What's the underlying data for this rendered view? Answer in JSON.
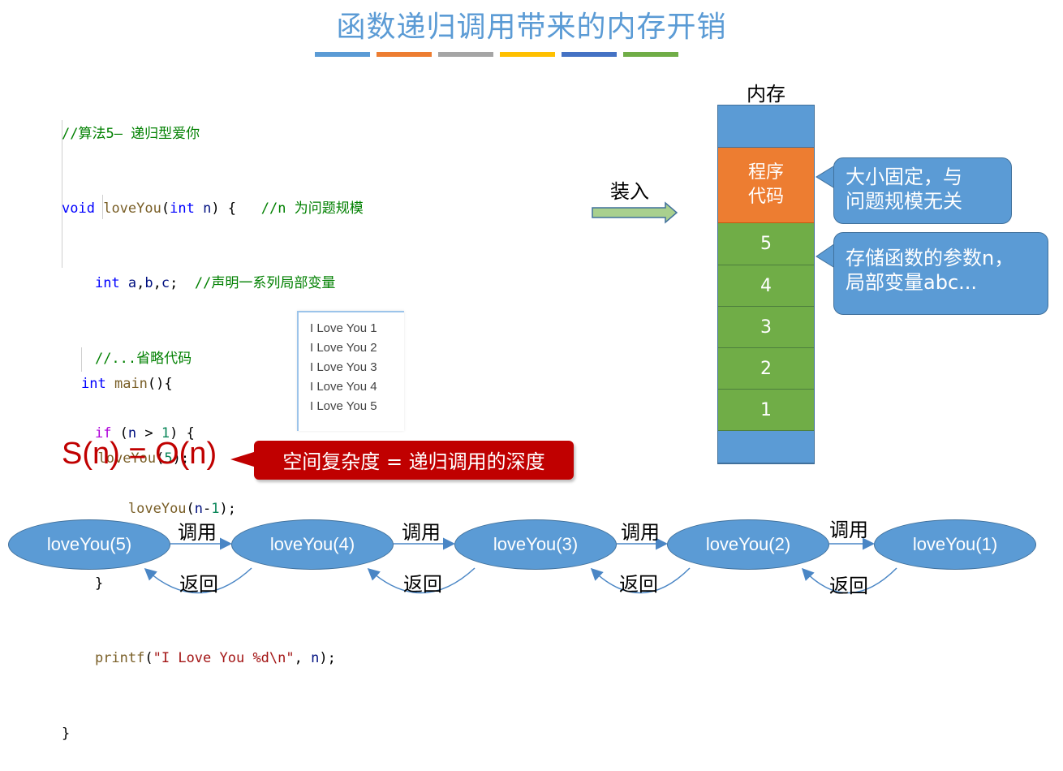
{
  "title": "函数递归调用带来的内存开销",
  "stripe_colors": [
    "#5b9bd5",
    "#ed7d31",
    "#a5a5a5",
    "#ffc000",
    "#4472c4",
    "#70ad47"
  ],
  "code": {
    "lines": [
      "//算法5— 递归型爱你",
      "void loveYou(int n) {   //n 为问题规模",
      "    int a,b,c;  //声明一系列局部变量",
      "    //...省略代码",
      "    if (n > 1) {",
      "        loveYou(n-1);",
      "    }",
      "    printf(\"I Love You %d\\n\", n);",
      "}"
    ],
    "main_lines": [
      "int main(){",
      "  loveYou(5);",
      "}"
    ]
  },
  "console": {
    "lines": [
      "I Love You 1",
      "I Love You 2",
      "I Love You 3",
      "I Love You 4",
      "I Love You 5"
    ]
  },
  "load_label": "装入",
  "memory": {
    "label": "内存",
    "cells": [
      {
        "text": "",
        "color": "#5b9bd5"
      },
      {
        "text": "程序\n代码",
        "color": "#ed7d31"
      },
      {
        "text": "5",
        "color": "#70ad47"
      },
      {
        "text": "4",
        "color": "#70ad47"
      },
      {
        "text": "3",
        "color": "#70ad47"
      },
      {
        "text": "2",
        "color": "#70ad47"
      },
      {
        "text": "1",
        "color": "#70ad47"
      },
      {
        "text": "",
        "color": "#5b9bd5"
      }
    ]
  },
  "callouts": {
    "code_size": "大小固定，与\n问题规模无关",
    "stack_frames": "存储函数的参数n，\n局部变量abc..."
  },
  "complexity": {
    "formula": "S(n) = O(n)",
    "note": "空间复杂度 = 递归调用的深度"
  },
  "call_chain": {
    "nodes": [
      "loveYou(5)",
      "loveYou(4)",
      "loveYou(3)",
      "loveYou(2)",
      "loveYou(1)"
    ],
    "call_label": "调用",
    "return_label": "返回"
  }
}
